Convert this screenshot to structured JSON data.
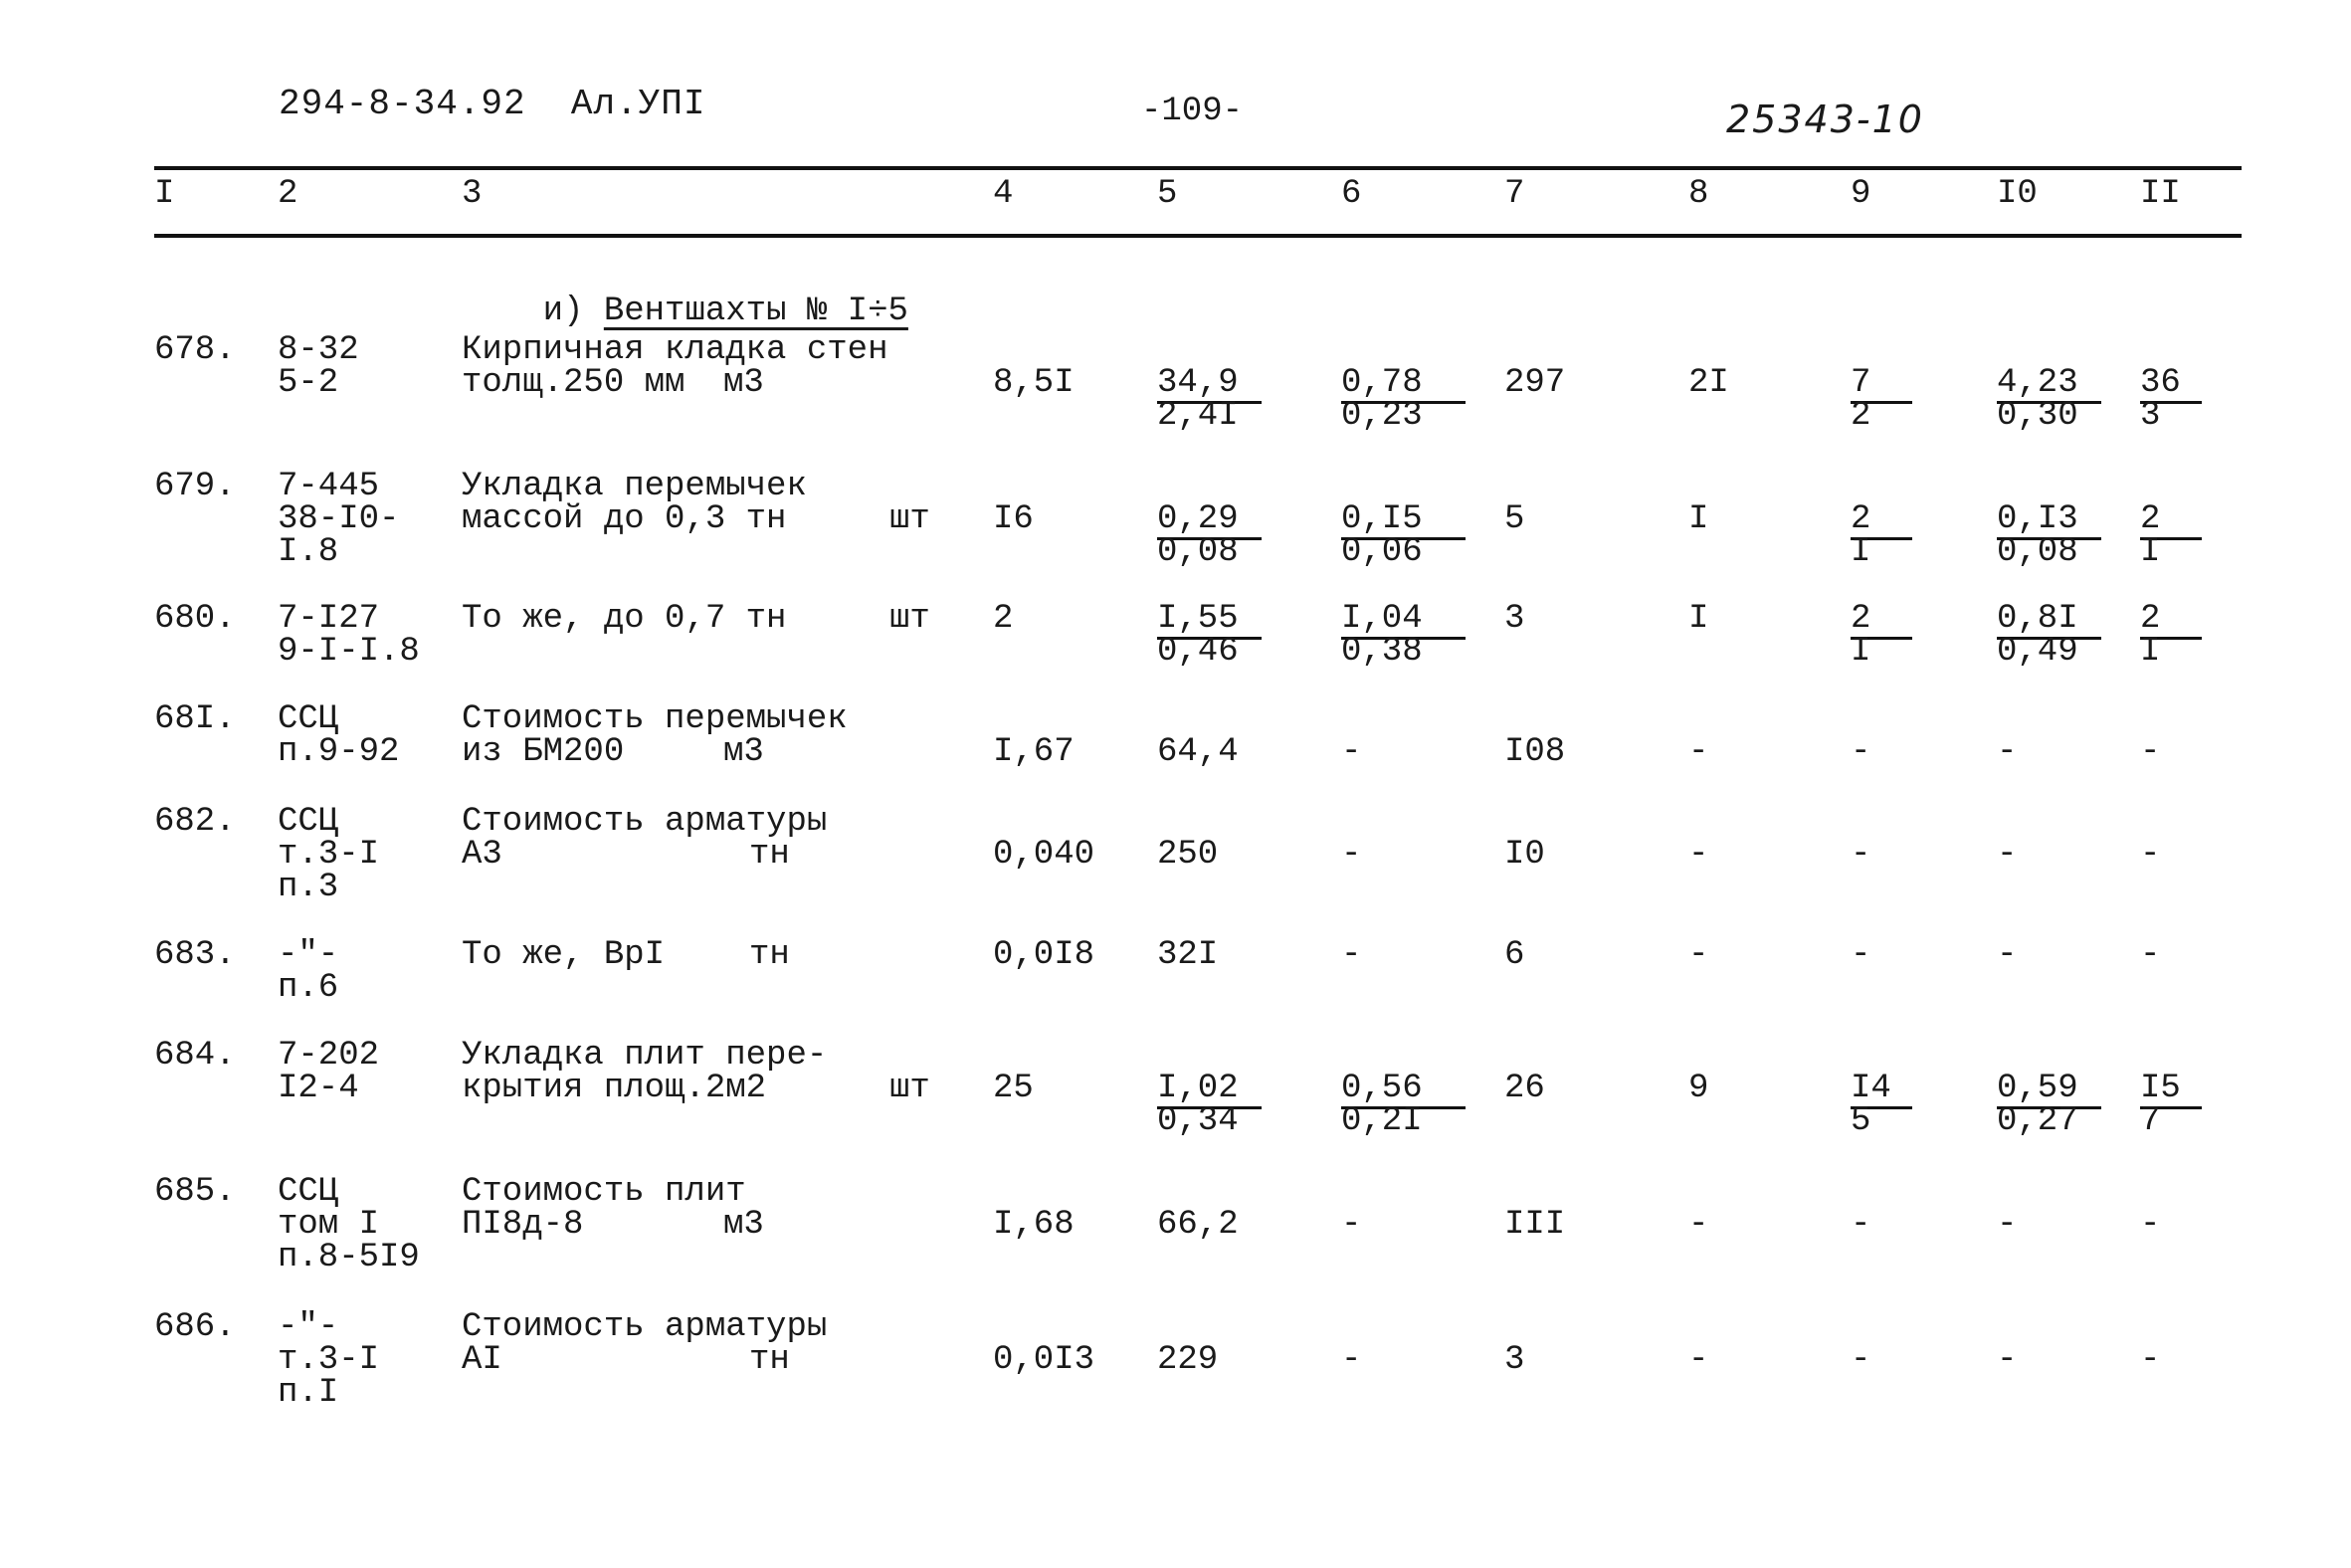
{
  "header": {
    "doc_code": "294-8-34.92  Ал.УПI",
    "page_number": "-109-",
    "archive_number": "25343-10"
  },
  "column_headers": [
    "I",
    "2",
    "3",
    "4",
    "5",
    "6",
    "7",
    "8",
    "9",
    "I0",
    "II"
  ],
  "section": {
    "prefix": "и)",
    "title": "Вентшахты № I÷5"
  },
  "rows": [
    {
      "no": "678.",
      "code": [
        "8-32",
        "5-2"
      ],
      "desc": [
        "Кирпичная кладка стен",
        "толщ.250 мм"
      ],
      "unit": "м3",
      "qty": "8,5I",
      "c5": {
        "top": "34,9",
        "bottom": "2,4I"
      },
      "c6": {
        "top": "0,78",
        "bottom": "0,23"
      },
      "c7": "297",
      "c8": "2I",
      "c9": {
        "top": "7",
        "bottom": "2"
      },
      "c10": {
        "top": "4,23",
        "bottom": "0,30"
      },
      "c11": {
        "top": "36",
        "bottom": "3"
      }
    },
    {
      "no": "679.",
      "code": [
        "7-445",
        "38-I0-",
        "I.8"
      ],
      "desc": [
        "Укладка перемычек",
        "массой до 0,3 тн"
      ],
      "unit": "шт",
      "qty": "I6",
      "c5": {
        "top": "0,29",
        "bottom": "0,08"
      },
      "c6": {
        "top": "0,I5",
        "bottom": "0,06"
      },
      "c7": "5",
      "c8": "I",
      "c9": {
        "top": "2",
        "bottom": "I"
      },
      "c10": {
        "top": "0,I3",
        "bottom": "0,08"
      },
      "c11": {
        "top": "2",
        "bottom": "I"
      }
    },
    {
      "no": "680.",
      "code": [
        "7-I27",
        "9-I-I.8"
      ],
      "desc": [
        "То же, до 0,7 тн"
      ],
      "unit": "шт",
      "qty": "2",
      "c5": {
        "top": "I,55",
        "bottom": "0,46"
      },
      "c6": {
        "top": "I,04",
        "bottom": "0,38"
      },
      "c7": "3",
      "c8": "I",
      "c9": {
        "top": "2",
        "bottom": "I"
      },
      "c10": {
        "top": "0,8I",
        "bottom": "0,49"
      },
      "c11": {
        "top": "2",
        "bottom": "I"
      }
    },
    {
      "no": "68I.",
      "code": [
        "ССЦ",
        "п.9-92"
      ],
      "desc": [
        "Стоимость перемычек",
        "из БМ200"
      ],
      "unit": "м3",
      "qty": "I,67",
      "c5": "64,4",
      "c6": "-",
      "c7": "I08",
      "c8": "-",
      "c9": "-",
      "c10": "-",
      "c11": "-"
    },
    {
      "no": "682.",
      "code": [
        "ССЦ",
        "т.3-I",
        "п.3"
      ],
      "desc": [
        "Стоимость арматуры",
        "А3"
      ],
      "unit": "тн",
      "qty": "0,040",
      "c5": "250",
      "c6": "-",
      "c7": "I0",
      "c8": "-",
      "c9": "-",
      "c10": "-",
      "c11": "-"
    },
    {
      "no": "683.",
      "code": [
        "-\"-",
        "п.6"
      ],
      "desc": [
        "То же, ВрI"
      ],
      "unit": "тн",
      "qty": "0,0I8",
      "c5": "32I",
      "c6": "-",
      "c7": "6",
      "c8": "-",
      "c9": "-",
      "c10": "-",
      "c11": "-"
    },
    {
      "no": "684.",
      "code": [
        "7-202",
        "I2-4"
      ],
      "desc": [
        "Укладка плит пере-",
        "крытия площ.2м2"
      ],
      "unit": "шт",
      "qty": "25",
      "c5": {
        "top": "I,02",
        "bottom": "0,34"
      },
      "c6": {
        "top": "0,56",
        "bottom": "0,2I"
      },
      "c7": "26",
      "c8": "9",
      "c9": {
        "top": "I4",
        "bottom": "5"
      },
      "c10": {
        "top": "0,59",
        "bottom": "0,27"
      },
      "c11": {
        "top": "I5",
        "bottom": "7"
      }
    },
    {
      "no": "685.",
      "code": [
        "ССЦ",
        "том I",
        "п.8-5I9"
      ],
      "desc": [
        "Стоимость плит",
        "ПI8д-8"
      ],
      "unit": "м3",
      "qty": "I,68",
      "c5": "66,2",
      "c6": "-",
      "c7": "III",
      "c8": "-",
      "c9": "-",
      "c10": "-",
      "c11": "-"
    },
    {
      "no": "686.",
      "code": [
        "-\"-",
        "т.3-I",
        "п.I"
      ],
      "desc": [
        "Стоимость арматуры",
        "АI"
      ],
      "unit": "тн",
      "qty": "0,0I3",
      "c5": "229",
      "c6": "-",
      "c7": "3",
      "c8": "-",
      "c9": "-",
      "c10": "-",
      "c11": "-"
    }
  ]
}
